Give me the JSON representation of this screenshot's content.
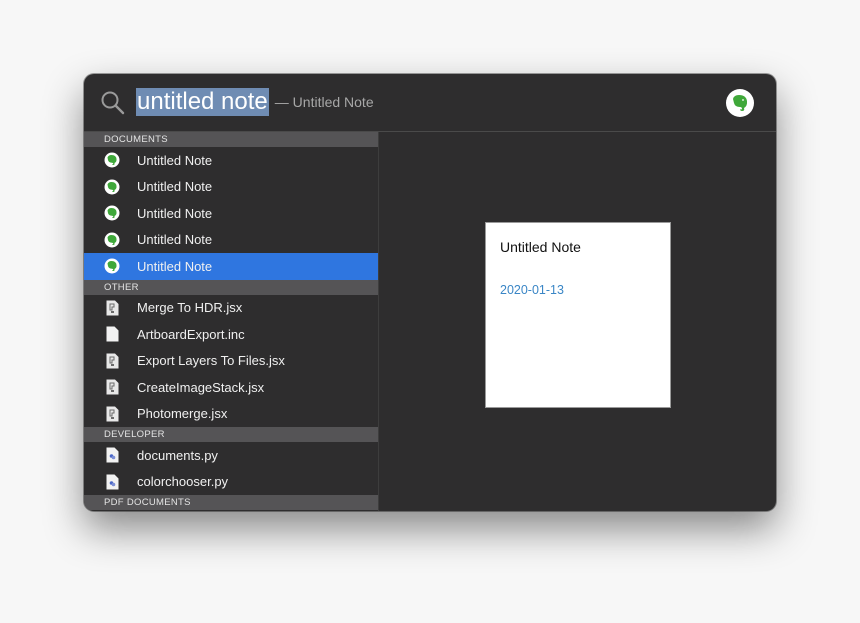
{
  "search": {
    "query": "untitled note",
    "hint": "— Untitled Note",
    "app_icon": "evernote-icon"
  },
  "sections": [
    {
      "title": "DOCUMENTS",
      "items": [
        {
          "label": "Untitled Note",
          "icon": "evernote-icon",
          "selected": false
        },
        {
          "label": "Untitled Note",
          "icon": "evernote-icon",
          "selected": false
        },
        {
          "label": "Untitled Note",
          "icon": "evernote-icon",
          "selected": false
        },
        {
          "label": "Untitled Note",
          "icon": "evernote-icon",
          "selected": false
        },
        {
          "label": "Untitled Note",
          "icon": "evernote-icon",
          "selected": true
        }
      ]
    },
    {
      "title": "OTHER",
      "items": [
        {
          "label": "Merge To HDR.jsx",
          "icon": "script-file-icon"
        },
        {
          "label": "ArtboardExport.inc",
          "icon": "blank-file-icon"
        },
        {
          "label": "Export Layers To Files.jsx",
          "icon": "script-file-icon"
        },
        {
          "label": "CreateImageStack.jsx",
          "icon": "script-file-icon"
        },
        {
          "label": "Photomerge.jsx",
          "icon": "script-file-icon"
        }
      ]
    },
    {
      "title": "DEVELOPER",
      "items": [
        {
          "label": "documents.py",
          "icon": "python-file-icon"
        },
        {
          "label": "colorchooser.py",
          "icon": "python-file-icon"
        }
      ]
    },
    {
      "title": "PDF DOCUMENTS",
      "items": []
    }
  ],
  "preview": {
    "title": "Untitled Note",
    "date": "2020-01-13"
  },
  "colors": {
    "selection": "#2f76e0",
    "evernote_green": "#3fa83a",
    "date_link": "#3a86c6"
  }
}
